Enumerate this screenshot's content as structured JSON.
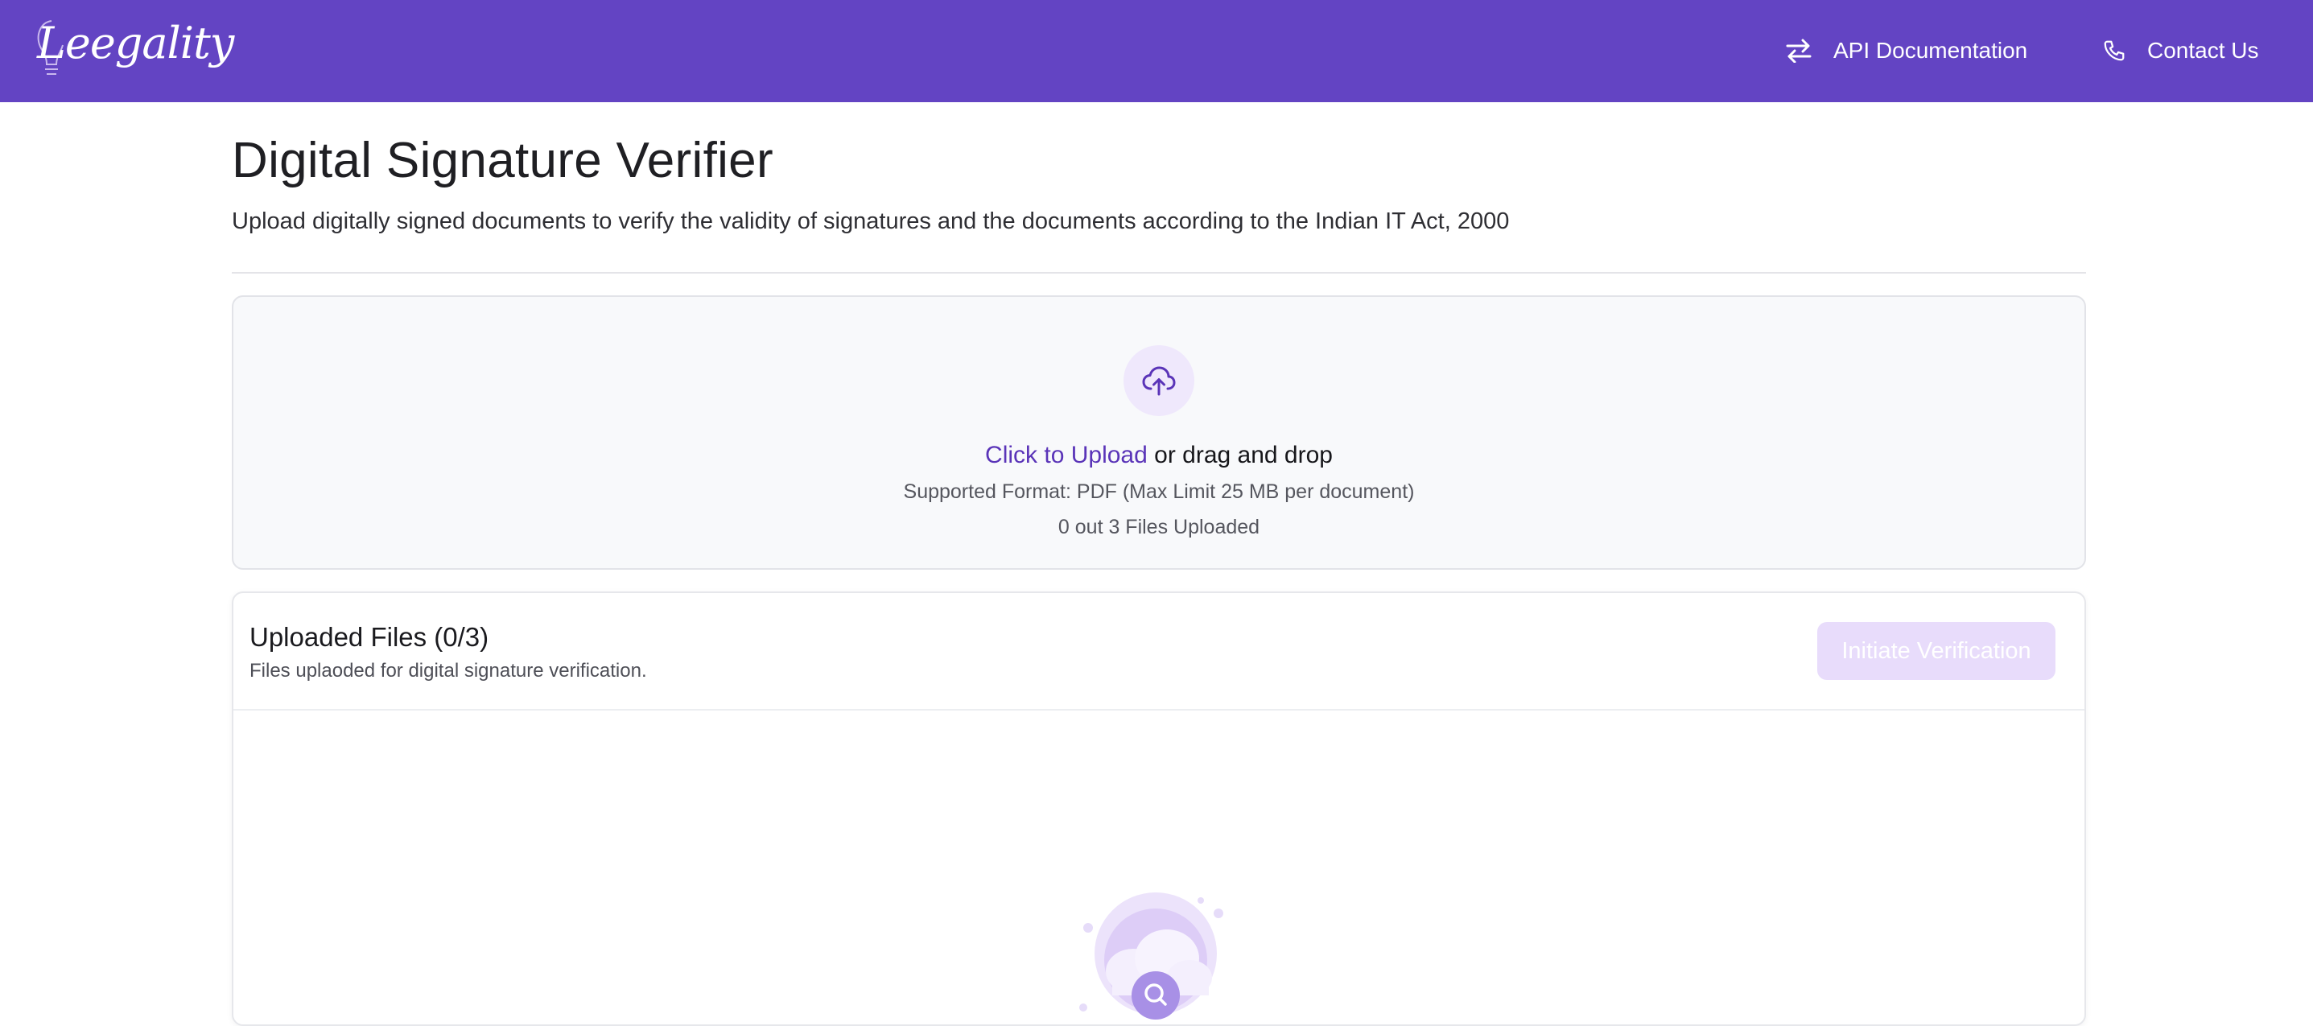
{
  "header": {
    "logo_text": "Leegality",
    "nav": {
      "api_docs_label": "API Documentation",
      "contact_label": "Contact Us"
    },
    "background_color": "#6344c3"
  },
  "main": {
    "title": "Digital Signature Verifier",
    "subtitle": "Upload digitally signed documents to verify the validity of signatures and the documents according to the Indian IT Act, 2000"
  },
  "upload": {
    "link_text": "Click to Upload",
    "rest_text": " or drag and drop",
    "format_text": "Supported Format: PDF (Max Limit 25 MB per document)",
    "count_text": "0 out 3 Files Uploaded",
    "icon": "cloud-upload-icon",
    "accent_color": "#5a34b8"
  },
  "files": {
    "title": "Uploaded Files (0/3)",
    "description": "Files uplaoded for digital signature verification.",
    "initiate_button_label": "Initiate Verification",
    "empty_state_icon": "empty-search-illustration"
  }
}
